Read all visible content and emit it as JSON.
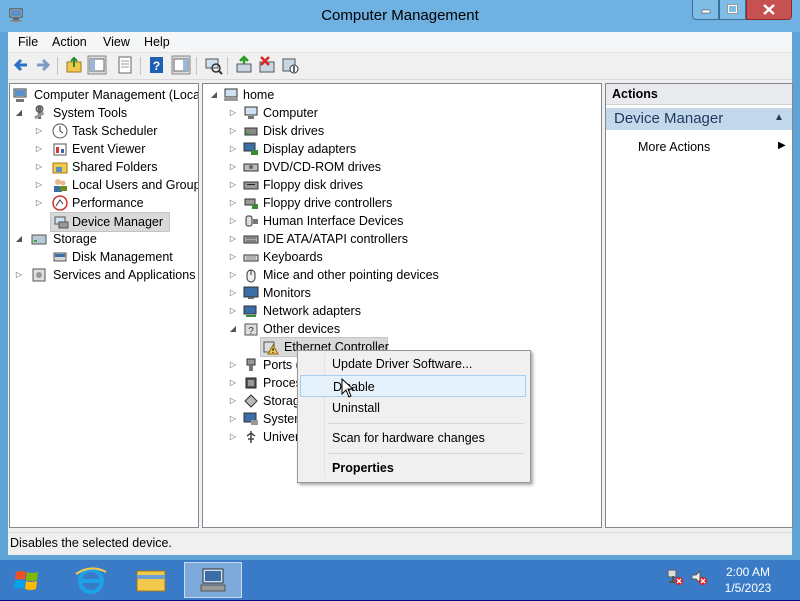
{
  "window": {
    "title": "Computer Management"
  },
  "menu": {
    "file": "File",
    "action": "Action",
    "view": "View",
    "help": "Help"
  },
  "left_tree": {
    "root": "Computer Management (Local",
    "system_tools": "System Tools",
    "task_scheduler": "Task Scheduler",
    "event_viewer": "Event Viewer",
    "shared_folders": "Shared Folders",
    "local_users": "Local Users and Groups",
    "performance": "Performance",
    "device_manager": "Device Manager",
    "storage": "Storage",
    "disk_management": "Disk Management",
    "services_apps": "Services and Applications"
  },
  "device_tree": {
    "root": "home",
    "items": [
      "Computer",
      "Disk drives",
      "Display adapters",
      "DVD/CD-ROM drives",
      "Floppy disk drives",
      "Floppy drive controllers",
      "Human Interface Devices",
      "IDE ATA/ATAPI controllers",
      "Keyboards",
      "Mice and other pointing devices",
      "Monitors",
      "Network adapters",
      "Other devices"
    ],
    "ethernet": "Ethernet Controller",
    "partial": [
      "Ports (",
      "Proces",
      "Storag",
      "Syster",
      "Univer"
    ]
  },
  "actions": {
    "header": "Actions",
    "section": "Device Manager",
    "more": "More Actions"
  },
  "context_menu": {
    "update": "Update Driver Software...",
    "disable": "Disable",
    "uninstall": "Uninstall",
    "scan": "Scan for hardware changes",
    "properties": "Properties"
  },
  "status": {
    "text": "Disables the selected device."
  },
  "taskbar": {
    "time": "2:00 AM",
    "date": "1/5/2023"
  },
  "colors": {
    "title_bar": "#6fb1e0",
    "taskbar": "#3a7bc8",
    "menu_hover": "#e5f1fb",
    "selection": "#d9d9d9"
  }
}
